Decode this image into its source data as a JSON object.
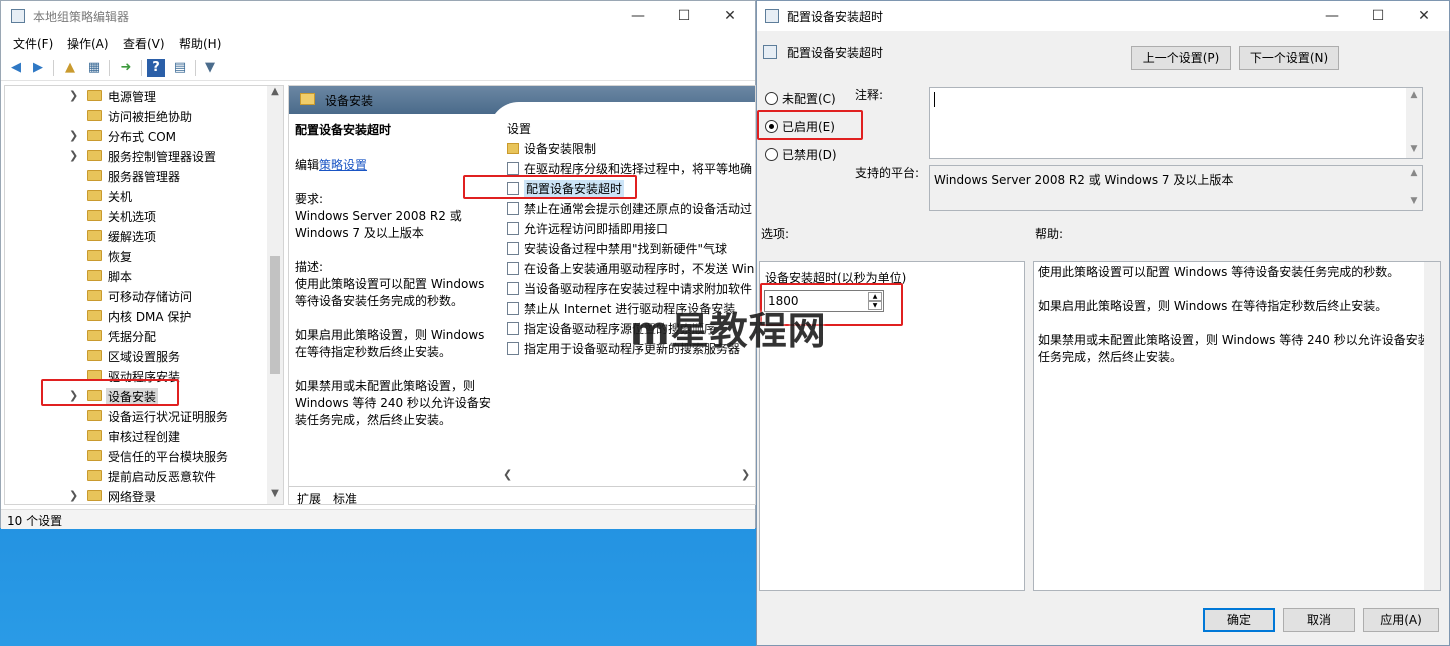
{
  "gpe": {
    "title": "本地组策略编辑器",
    "menu": [
      "文件(F)",
      "操作(A)",
      "查看(V)",
      "帮助(H)"
    ],
    "tree_items": [
      {
        "label": "电源管理",
        "chev": true
      },
      {
        "label": "访问被拒绝协助",
        "chev": false
      },
      {
        "label": "分布式 COM",
        "chev": true
      },
      {
        "label": "服务控制管理器设置",
        "chev": true
      },
      {
        "label": "服务器管理器",
        "chev": false
      },
      {
        "label": "关机",
        "chev": false
      },
      {
        "label": "关机选项",
        "chev": false
      },
      {
        "label": "缓解选项",
        "chev": false
      },
      {
        "label": "恢复",
        "chev": false
      },
      {
        "label": "脚本",
        "chev": false
      },
      {
        "label": "可移动存储访问",
        "chev": false
      },
      {
        "label": "内核 DMA 保护",
        "chev": false
      },
      {
        "label": "凭据分配",
        "chev": false
      },
      {
        "label": "区域设置服务",
        "chev": false
      },
      {
        "label": "驱动程序安装",
        "chev": false
      },
      {
        "label": "设备安装",
        "chev": true,
        "selected": true
      },
      {
        "label": "设备运行状况证明服务",
        "chev": false
      },
      {
        "label": "审核过程创建",
        "chev": false
      },
      {
        "label": "受信任的平台模块服务",
        "chev": false
      },
      {
        "label": "提前启动反恶意软件",
        "chev": false
      },
      {
        "label": "网络登录",
        "chev": true
      }
    ],
    "pane_header": "设备安装",
    "desc": {
      "title": "配置设备安装超时",
      "edit_prefix": "编辑",
      "edit_link": "策略设置",
      "req_label": "要求:",
      "req_text": "Windows Server 2008 R2 或 Windows 7 及以上版本",
      "desc_label": "描述:",
      "desc_text": "使用此策略设置可以配置 Windows 等待设备安装任务完成的秒数。",
      "enabled_text": "如果启用此策略设置，则 Windows 在等待指定秒数后终止安装。",
      "disabled_text": "如果禁用或未配置此策略设置，则 Windows 等待 240 秒以允许设备安装任务完成，然后终止安装。"
    },
    "settings_header": "设置",
    "settings": [
      {
        "label": "设备安装限制",
        "folder": true
      },
      {
        "label": "在驱动程序分级和选择过程中，将平等地确",
        "folder": false
      },
      {
        "label": "配置设备安装超时",
        "folder": false,
        "selected": true
      },
      {
        "label": "禁止在通常会提示创建还原点的设备活动过",
        "folder": false
      },
      {
        "label": "允许远程访问即插即用接口",
        "folder": false
      },
      {
        "label": "安装设备过程中禁用\"找到新硬件\"气球",
        "folder": false
      },
      {
        "label": "在设备上安装通用驱动程序时，不发送 Win",
        "folder": false
      },
      {
        "label": "当设备驱动程序在安装过程中请求附加软件",
        "folder": false
      },
      {
        "label": "禁止从 Internet 进行驱动程序设备安装",
        "folder": false
      },
      {
        "label": "指定设备驱动程序源位置的搜索顺序",
        "folder": false
      },
      {
        "label": "指定用于设备驱动程序更新的搜索服务器",
        "folder": false
      }
    ],
    "tabs": [
      "扩展",
      "标准"
    ],
    "status": "10 个设置"
  },
  "dialog": {
    "title": "配置设备安装超时",
    "policy_title": "配置设备安装超时",
    "prev_btn": "上一个设置(P)",
    "next_btn": "下一个设置(N)",
    "radio_not_configured": "未配置(C)",
    "radio_enabled": "已启用(E)",
    "radio_disabled": "已禁用(D)",
    "selected_radio": "enabled",
    "comment_label": "注释:",
    "comment_value": "",
    "platform_label": "支持的平台:",
    "platform_value": "Windows Server 2008 R2 或 Windows 7 及以上版本",
    "options_label": "选项:",
    "help_label": "帮助:",
    "timeout_label": "设备安装超时(以秒为单位)",
    "timeout_value": "1800",
    "help_paragraphs": [
      "使用此策略设置可以配置 Windows 等待设备安装任务完成的秒数。",
      "如果启用此策略设置，则 Windows 在等待指定秒数后终止安装。",
      "如果禁用或未配置此策略设置，则 Windows 等待 240 秒以允许设备安装任务完成，然后终止安装。"
    ],
    "ok_btn": "确定",
    "cancel_btn": "取消",
    "apply_btn": "应用(A)"
  },
  "watermark": "m星教程网",
  "colors": {
    "highlight": "#e02020",
    "link": "#1a55c4",
    "accent": "#0078d7"
  }
}
